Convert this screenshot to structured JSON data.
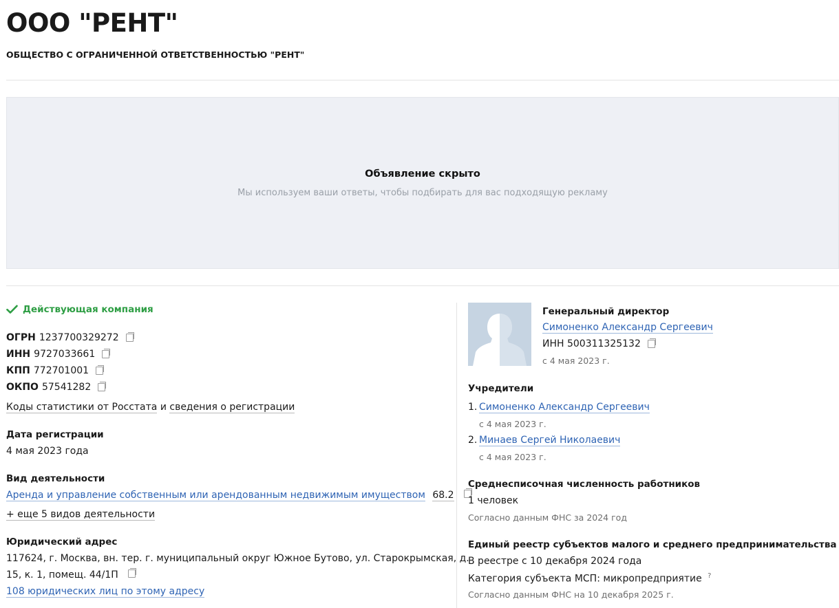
{
  "company": {
    "short_name": "ООО \"РЕНТ\"",
    "full_name": "ОБЩЕСТВО С ОГРАНИЧЕННОЙ ОТВЕТСТВЕННОСТЬЮ \"РЕНТ\""
  },
  "ad": {
    "title": "Объявление скрыто",
    "subtitle": "Мы используем ваши ответы, чтобы подбирать для вас подходящую рекламу"
  },
  "status": {
    "label": "Действующая компания",
    "color": "#2e9e44",
    "icon": "check-icon"
  },
  "ids": [
    {
      "label": "ОГРН",
      "value": "1237700329272"
    },
    {
      "label": "ИНН",
      "value": "9727033661"
    },
    {
      "label": "КПП",
      "value": "772701001"
    },
    {
      "label": "ОКПО",
      "value": "57541282"
    }
  ],
  "stats_link": {
    "part1": "Коды статистики от Росстата",
    "joiner": " и ",
    "part2": "сведения о регистрации"
  },
  "registration": {
    "label": "Дата регистрации",
    "value": "4 мая 2023 года"
  },
  "activity": {
    "label": "Вид деятельности",
    "main": "Аренда и управление собственным или арендованным недвижимым имуществом",
    "code": "68.2",
    "more": "+ еще 5 видов деятельности"
  },
  "address": {
    "label": "Юридический адрес",
    "line1": "117624, г. Москва, вн. тер. г. муниципальный округ Южное Бутово, ул. Старокрымская, д.",
    "line2": "15, к. 1, помещ. 44/1П",
    "entities_link": "108 юридических лиц по этому адресу"
  },
  "director": {
    "role": "Генеральный директор",
    "name": "Симоненко Александр Сергеевич",
    "inn": "ИНН 500311325132",
    "since": "с 4 мая 2023 г."
  },
  "founders": {
    "label": "Учредители",
    "items": [
      {
        "num": "1.",
        "name": "Симоненко Александр Сергеевич",
        "since": "с 4 мая 2023 г."
      },
      {
        "num": "2.",
        "name": "Минаев Сергей Николаевич",
        "since": "с 4 мая 2023 г."
      }
    ]
  },
  "employees": {
    "label": "Среднесписочная численность работников",
    "value": "1 человек",
    "source": "Согласно данным ФНС за 2024 год"
  },
  "msp": {
    "label": "Единый реестр субъектов малого и среднего предпринимательства",
    "in_registry": "В реестре с 10 декабря 2024 года",
    "category": "Категория субъекта МСП: микропредприятие",
    "hint": "?",
    "source": "Согласно данным ФНС на 10 декабря 2025 г."
  }
}
